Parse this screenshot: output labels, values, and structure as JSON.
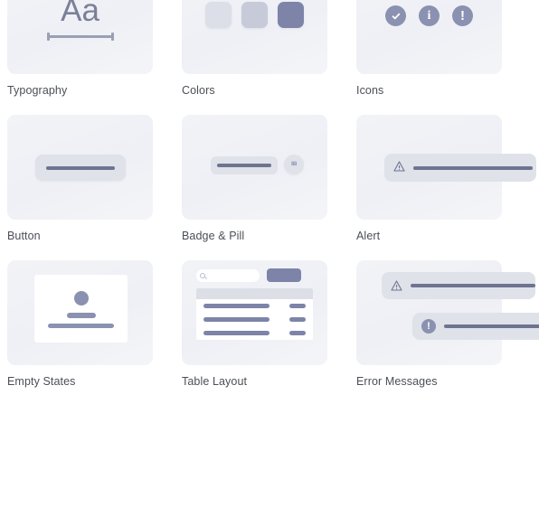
{
  "gallery": {
    "background": "#ffffff",
    "card_background": "#f0f2f6",
    "accent": "#7d84a8",
    "bar_color": "#6e7490",
    "label_color": "#4b4f57",
    "cards": [
      {
        "id": "typography",
        "label": "Typography",
        "sample_text": "Aa",
        "icons": [
          "text-size-icon",
          "measure-rule-icon"
        ]
      },
      {
        "id": "colors",
        "label": "Colors",
        "swatches": [
          "#dcdfe8",
          "#c7cbd9",
          "#7d84a8"
        ],
        "icons": [
          "color-swatch-icon"
        ]
      },
      {
        "id": "icons",
        "label": "Icons",
        "glyphs": [
          "check",
          "i",
          "!"
        ],
        "icon_color": "#8b91b0",
        "icons": [
          "check-circle-icon",
          "info-circle-icon",
          "exclamation-circle-icon"
        ]
      },
      {
        "id": "button",
        "label": "Button",
        "icons": [
          "button-shape-icon"
        ]
      },
      {
        "id": "badge-pill",
        "label": "Badge & Pill",
        "badge_text": "88",
        "icons": [
          "pill-shape-icon",
          "badge-circle-icon"
        ]
      },
      {
        "id": "alert",
        "label": "Alert",
        "icons": [
          "warning-triangle-icon"
        ]
      },
      {
        "id": "empty-states",
        "label": "Empty States",
        "icons": [
          "empty-state-illustration-icon"
        ]
      },
      {
        "id": "table-layout",
        "label": "Table Layout",
        "row_count": 3,
        "icons": [
          "search-icon",
          "primary-button-icon",
          "table-header-icon"
        ]
      },
      {
        "id": "error-messages",
        "label": "Error Messages",
        "glyphs": [
          "!"
        ],
        "icons": [
          "warning-triangle-icon",
          "exclamation-circle-icon"
        ]
      }
    ]
  }
}
